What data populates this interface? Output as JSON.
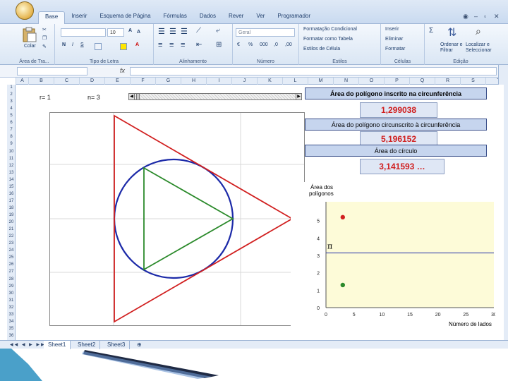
{
  "ribbon_tabs": [
    "Base",
    "Inserir",
    "Esquema de Página",
    "Fórmulas",
    "Dados",
    "Rever",
    "Ver",
    "Programador"
  ],
  "ribbon": {
    "groups": [
      "Área de Tra...",
      "Tipo de Letra",
      "Alinhamento",
      "Número",
      "Estilos",
      "Células",
      "Edição"
    ],
    "paste_label": "Colar",
    "font_size": "10",
    "number_format": "Geral",
    "styles_items": [
      "Formatação Condicional",
      "Formatar como Tabela",
      "Estilos de Célula"
    ],
    "cells_items": [
      "Inserir",
      "Eliminar",
      "Formatar"
    ],
    "edit_items": [
      "Ordenar e Filtrar",
      "Localizar e Seleccionar"
    ]
  },
  "formula_bar": {
    "fx": "fx"
  },
  "columns": [
    "A",
    "B",
    "C",
    "D",
    "E",
    "F",
    "G",
    "H",
    "I",
    "J",
    "K",
    "L",
    "M",
    "N",
    "O",
    "P",
    "Q",
    "R",
    "S",
    "T"
  ],
  "rows": [
    "1",
    "2",
    "3",
    "4",
    "5",
    "6",
    "7",
    "8",
    "9",
    "10",
    "11",
    "12",
    "13",
    "14",
    "15",
    "16",
    "17",
    "18",
    "19",
    "20",
    "21",
    "22",
    "23",
    "24",
    "25",
    "26",
    "27",
    "28",
    "29",
    "30",
    "31",
    "32",
    "33",
    "34",
    "35",
    "36"
  ],
  "controls": {
    "r_label": "r= 1",
    "n_label": "n= 3"
  },
  "info": {
    "inscribed_title": "Área do polígono inscrito na circunferência",
    "inscribed_value": "1,299038",
    "circumscribed_title": "Área do polígono circunscrito à circunferência",
    "circumscribed_value": "5,196152",
    "circle_title": "Área do círculo",
    "circle_value": "3,141593 …"
  },
  "chart_data": {
    "type": "scatter",
    "ylabel": "Área dos polígonos",
    "xlabel": "Número de lados",
    "xlim": [
      0,
      30
    ],
    "ylim": [
      0,
      6
    ],
    "x_ticks": [
      "0",
      "5",
      "10",
      "15",
      "20",
      "25",
      "30"
    ],
    "y_ticks": [
      "0",
      "1",
      "2",
      "3",
      "4",
      "5"
    ],
    "pi_label": "π",
    "pi_value": 3.141593,
    "series": [
      {
        "x": [
          3
        ],
        "y": [
          5.196152
        ],
        "color": "#d11f1f"
      },
      {
        "x": [
          3
        ],
        "y": [
          1.299038
        ],
        "color": "#2b8a2b"
      }
    ],
    "background": "#fdfbd8",
    "grid": false
  },
  "sheet_tabs": [
    "Sheet1",
    "Sheet2",
    "Sheet3"
  ],
  "colors": {
    "circle": "#1c2aa8",
    "circumscribed": "#d11f1f",
    "inscribed": "#2b8a2b",
    "info_header": "#c6d5ee",
    "value_text": "#d01e1e"
  }
}
